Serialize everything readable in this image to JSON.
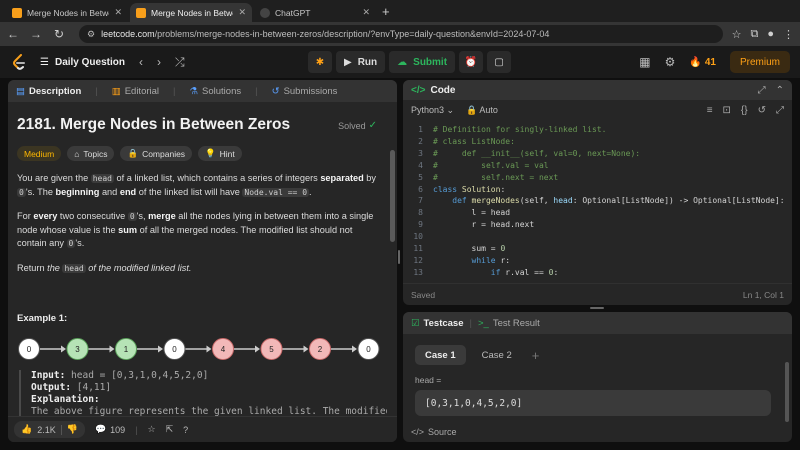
{
  "browser": {
    "tabs": [
      {
        "title": "Merge Nodes in Between Zeros",
        "active": false
      },
      {
        "title": "Merge Nodes in Between Zeros",
        "active": true
      },
      {
        "title": "ChatGPT",
        "active": false
      }
    ],
    "url_host": "leetcode.com",
    "url_path": "/problems/merge-nodes-in-between-zeros/description/?envType=daily-question&envId=2024-07-04"
  },
  "navbar": {
    "daily_label": "Daily Question",
    "run_label": "Run",
    "submit_label": "Submit",
    "streak_count": "41",
    "premium_label": "Premium"
  },
  "left_tabs": [
    {
      "label": "Description",
      "active": true
    },
    {
      "label": "Editorial",
      "active": false
    },
    {
      "label": "Solutions",
      "active": false
    },
    {
      "label": "Submissions",
      "active": false
    }
  ],
  "problem": {
    "title": "2181. Merge Nodes in Between Zeros",
    "status": "Solved",
    "difficulty": "Medium",
    "tags": [
      "Topics",
      "Companies",
      "Hint"
    ],
    "p1": [
      {
        "t": "You are given the ",
        "s": "txt"
      },
      {
        "t": "head",
        "s": "code"
      },
      {
        "t": " of a linked list, which contains a series of integers ",
        "s": "txt"
      },
      {
        "t": "separated",
        "s": "bold"
      },
      {
        "t": " by ",
        "s": "txt"
      },
      {
        "t": "0",
        "s": "code"
      },
      {
        "t": "'s. The ",
        "s": "txt"
      },
      {
        "t": "beginning",
        "s": "bold"
      },
      {
        "t": " and ",
        "s": "txt"
      },
      {
        "t": "end",
        "s": "bold"
      },
      {
        "t": " of the linked list will have ",
        "s": "txt"
      },
      {
        "t": "Node.val == 0",
        "s": "code"
      },
      {
        "t": ".",
        "s": "txt"
      }
    ],
    "p2": [
      {
        "t": "For ",
        "s": "txt"
      },
      {
        "t": "every",
        "s": "bold"
      },
      {
        "t": " two consecutive ",
        "s": "txt"
      },
      {
        "t": "0",
        "s": "code"
      },
      {
        "t": "'s, ",
        "s": "txt"
      },
      {
        "t": "merge",
        "s": "bold"
      },
      {
        "t": " all the nodes lying in between them into a single node whose value is the ",
        "s": "txt"
      },
      {
        "t": "sum",
        "s": "bold"
      },
      {
        "t": " of all the merged nodes. The modified list should not contain any ",
        "s": "txt"
      },
      {
        "t": "0",
        "s": "code"
      },
      {
        "t": "'s.",
        "s": "txt"
      }
    ],
    "p3": [
      {
        "t": "Return ",
        "s": "txt"
      },
      {
        "t": "the ",
        "s": "ital"
      },
      {
        "t": "head",
        "s": "code"
      },
      {
        "t": " of the modified linked list.",
        "s": "ital"
      }
    ],
    "example_title": "Example 1:",
    "nodes": [
      "0",
      "3",
      "1",
      "0",
      "4",
      "5",
      "2",
      "0"
    ],
    "node_fills": [
      "#ffffff",
      "#b6e3b6",
      "#b6e3b6",
      "#ffffff",
      "#f2b8b8",
      "#f2b8b8",
      "#f2b8b8",
      "#ffffff"
    ],
    "node_strokes": [
      "#555555",
      "#5aa05a",
      "#5aa05a",
      "#555555",
      "#c96a6a",
      "#c96a6a",
      "#c96a6a",
      "#555555"
    ],
    "input_key": "Input:",
    "input_val": " head = [0,3,1,0,4,5,2,0]",
    "output_key": "Output:",
    "output_val": " [4,11]",
    "expl_key": "Explanation:",
    "expl_text": "The above figure represents the given linked list. The modified"
  },
  "footer": {
    "likes": "2.1K",
    "comments": "109"
  },
  "code": {
    "header": "Code",
    "language": "Python3",
    "mode": "Auto",
    "lines": [
      [
        {
          "t": "# Definition for singly-linked list.",
          "c": "cm"
        }
      ],
      [
        {
          "t": "# class ListNode:",
          "c": "cm"
        }
      ],
      [
        {
          "t": "#     def __init__(self, val=0, next=None):",
          "c": "cm"
        }
      ],
      [
        {
          "t": "#         self.val = val",
          "c": "cm"
        }
      ],
      [
        {
          "t": "#         self.next = next",
          "c": "cm"
        }
      ],
      [
        {
          "t": "class ",
          "c": "kw"
        },
        {
          "t": "Solution",
          "c": "fn"
        },
        {
          "t": ":",
          "c": "tx"
        }
      ],
      [
        {
          "t": "    ",
          "c": "tx"
        },
        {
          "t": "def ",
          "c": "kw"
        },
        {
          "t": "mergeNodes",
          "c": "fn"
        },
        {
          "t": "(self, ",
          "c": "tx"
        },
        {
          "t": "head",
          "c": "pm"
        },
        {
          "t": ": Optional[ListNode]) -> Optional[ListNode]:",
          "c": "tx"
        }
      ],
      [
        {
          "t": "        l = head",
          "c": "tx"
        }
      ],
      [
        {
          "t": "        r = head.next",
          "c": "tx"
        }
      ],
      [
        {
          "t": "",
          "c": "tx"
        }
      ],
      [
        {
          "t": "        sum = ",
          "c": "tx"
        },
        {
          "t": "0",
          "c": "nm"
        }
      ],
      [
        {
          "t": "        ",
          "c": "tx"
        },
        {
          "t": "while ",
          "c": "kw"
        },
        {
          "t": "r:",
          "c": "tx"
        }
      ],
      [
        {
          "t": "            ",
          "c": "tx"
        },
        {
          "t": "if ",
          "c": "kw"
        },
        {
          "t": "r.val == ",
          "c": "tx"
        },
        {
          "t": "0",
          "c": "nm"
        },
        {
          "t": ":",
          "c": "tx"
        }
      ]
    ],
    "saved_label": "Saved",
    "cursor_pos": "Ln 1, Col 1"
  },
  "testcase": {
    "tab_label": "Testcase",
    "result_label": "Test Result",
    "cases": [
      "Case 1",
      "Case 2"
    ],
    "plus": "+",
    "input_label": "head =",
    "input_value": "[0,3,1,0,4,5,2,0]",
    "source_label": "Source"
  }
}
